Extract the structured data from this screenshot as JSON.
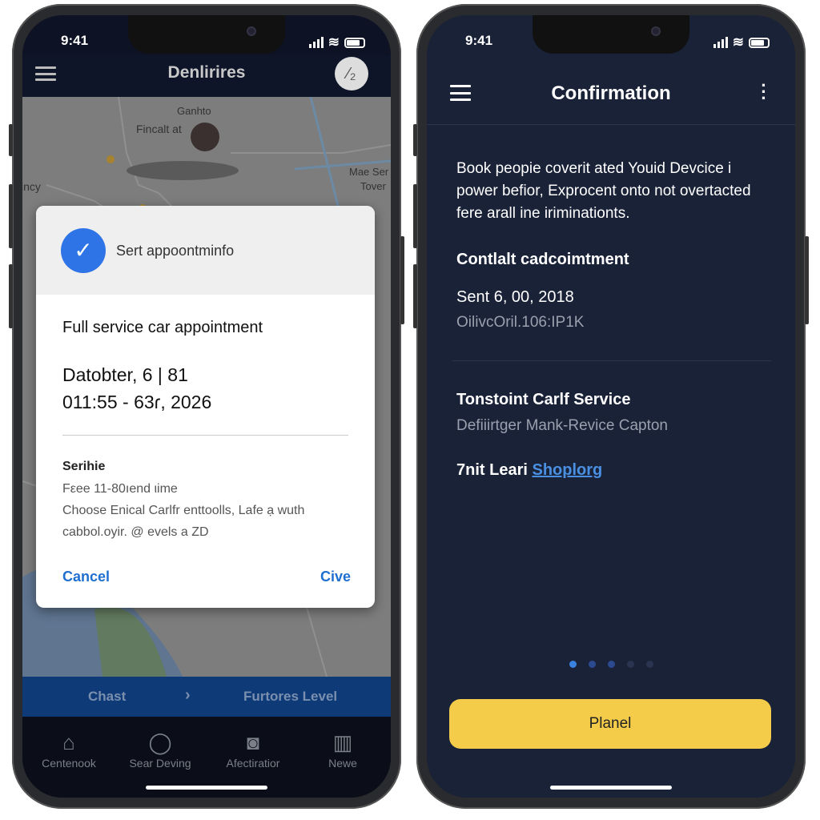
{
  "left": {
    "status_time": "9:41",
    "header": {
      "title": "Denlirires",
      "avatar_text": "⁄₂"
    },
    "map": {
      "labels": [
        "Ganhto",
        "Fincalt at",
        "Mae Ser",
        "Tover",
        "incy"
      ]
    },
    "dialog": {
      "header_text": "Sert appoontminfo",
      "icon": "check-icon",
      "title": "Full service car appointment",
      "date_line1": "Datobter, 6 | 81",
      "date_line2": "011:55 - 63ɾ, 2026",
      "section_label": "Serihie",
      "section_lines": [
        "Fεee 11-80ıend ιime",
        "Choose Enical Carlfr enttoolls, Lafe ạ wuth",
        "cabbol.oyir. @ evels a ZD"
      ],
      "cancel_label": "Cancel",
      "confirm_label": "Cive",
      "accent_color": "#1f6fd1"
    },
    "breadcrumb": {
      "items": [
        "Chast",
        "Furtores Level"
      ]
    },
    "tabs": [
      {
        "label": "Centenook",
        "icon": "home-icon"
      },
      {
        "label": "Sear Deving",
        "icon": "profile-icon"
      },
      {
        "label": "Afectiratior",
        "icon": "camera-icon"
      },
      {
        "label": "Newe",
        "icon": "panel-icon"
      }
    ]
  },
  "right": {
    "status_time": "9:41",
    "header": {
      "title": "Confirmation"
    },
    "intro": "Book peopie coverit ated Youid Devcice  i power befior, Exprocent onto not overtacted fere arall ine iriminationts.",
    "section1": {
      "title": "Contlalt cadcoimtment",
      "date": "Sent 6, 00, 2018",
      "code": "OilivcOril.106:IP1K"
    },
    "section2": {
      "title": "Tonstoint Carlf Service",
      "subtitle": "Defiiirtger Mank-Revice Capton",
      "prefix": "7nit Leari",
      "link": "Shoplorg"
    },
    "pager": {
      "count": 5,
      "active": 0
    },
    "button_label": "Planel",
    "button_color": "#f5cc4a"
  }
}
